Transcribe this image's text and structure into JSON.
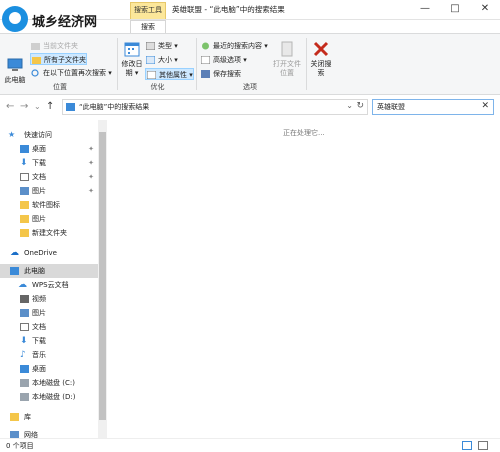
{
  "watermark": {
    "text": "城乡经济网"
  },
  "titlebar": {
    "context_tab": "搜索工具",
    "title": "英雄联盟 - “此电脑”中的搜索结果",
    "minimize": "—",
    "maximize": "□",
    "close": "✕"
  },
  "ribbon_tabs": {
    "active": "搜索"
  },
  "ribbon": {
    "location": {
      "this_pc": "此电脑",
      "current_folder": "当前文件夹",
      "all_subfolders": "所有子文件夹",
      "search_again": "在以下位置再次搜索 ▾",
      "label": "位置"
    },
    "refine": {
      "date_modified": "修改日期 ▾",
      "kind": "类型 ▾",
      "size": "大小 ▾",
      "other_properties": "其他属性 ▾",
      "label": "优化"
    },
    "options": {
      "recent_searches": "最近的搜索内容 ▾",
      "advanced_options": "高级选项 ▾",
      "save_search": "保存搜索",
      "open_location": "打开文件位置",
      "label": "选项"
    },
    "close": {
      "label": "关闭搜索"
    }
  },
  "address": {
    "path": "“此电脑”中的搜索结果",
    "search_value": "英雄联盟"
  },
  "nav": {
    "quick_access": "快速访问",
    "desktop": "桌面",
    "downloads": "下载",
    "documents": "文档",
    "pictures": "图片",
    "software_icons": "软件图标",
    "pictures2": "图片",
    "new_folder": "新建文件夹",
    "onedrive": "OneDrive",
    "this_pc": "此电脑",
    "wps_cloud": "WPS云文档",
    "videos": "视频",
    "pictures3": "图片",
    "documents2": "文档",
    "downloads2": "下载",
    "music": "音乐",
    "desktop2": "桌面",
    "local_c": "本地磁盘 (C:)",
    "local_d": "本地磁盘 (D:)",
    "library": "库",
    "network": "网络"
  },
  "content": {
    "processing": "正在处理它..."
  },
  "status": {
    "item_count": "0 个项目"
  },
  "colors": {
    "accent": "#1b8fe0",
    "context_tab": "#fce79a",
    "close_red": "#c42b1c",
    "folder": "#f4c64a"
  }
}
